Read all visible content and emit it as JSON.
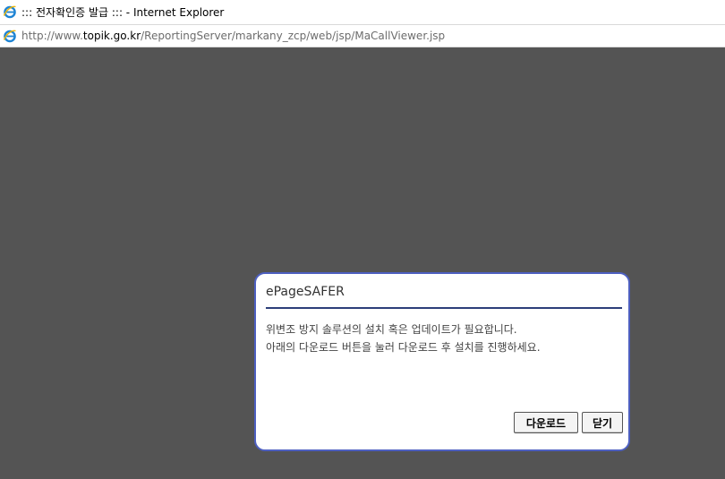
{
  "window": {
    "title": "::: 전자확인증 발급 ::: - Internet Explorer"
  },
  "address": {
    "url_prefix": "http://www.",
    "url_host": "topik.go.kr",
    "url_path": "/ReportingServer/markany_zcp/web/jsp/MaCallViewer.jsp"
  },
  "dialog": {
    "title": "ePageSAFER",
    "message_line1": "위변조 방지 솔루션의 설치 혹은 업데이트가 필요합니다.",
    "message_line2": "아래의 다운로드 버튼을 눌러 다운로드 후 설치를 진행하세요.",
    "download_label": "다운로드",
    "close_label": "닫기"
  },
  "colors": {
    "content_background": "#545454",
    "dialog_border": "#4d5fc0",
    "title_rule": "#2d3f7a"
  },
  "icons": {
    "browser": "ie-icon"
  }
}
